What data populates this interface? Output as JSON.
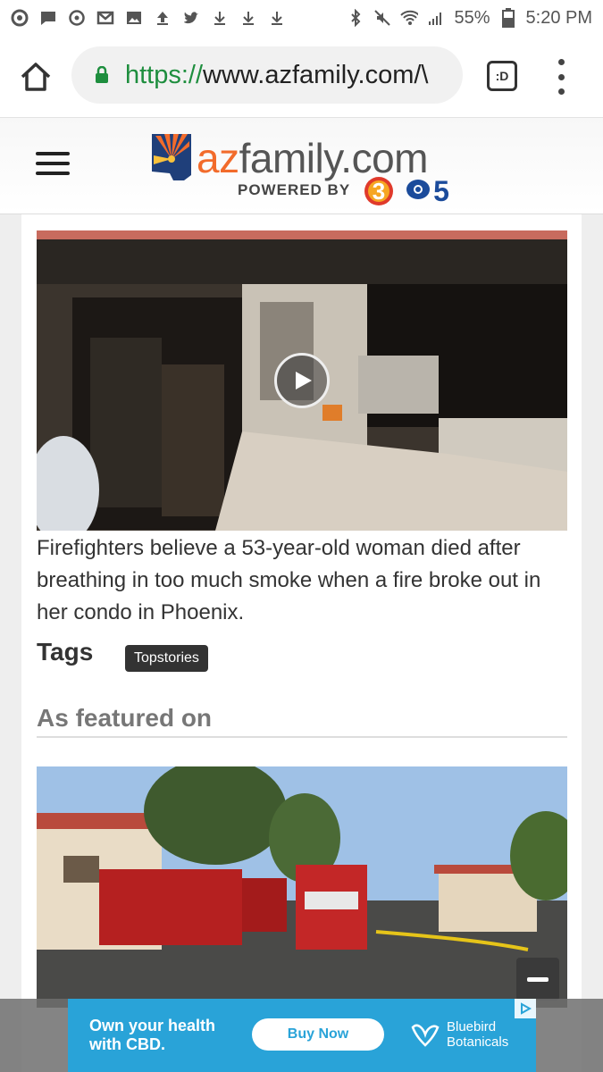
{
  "status_bar": {
    "battery": "55%",
    "time": "5:20 PM",
    "left_icons": [
      "chrome-icon",
      "message-icon",
      "sync-icon",
      "gmail-icon",
      "image-icon",
      "upload-icon",
      "twitter-icon",
      "download-icon",
      "download-icon",
      "download-icon"
    ],
    "right_icons": [
      "bluetooth-icon",
      "mute-icon",
      "wifi-icon",
      "signal-icon",
      "battery-icon"
    ]
  },
  "browser": {
    "url_scheme": "https://",
    "url_host": "www.azfamily.com/\\",
    "tab_label": ":D"
  },
  "site": {
    "logo_az": "az",
    "logo_rest": "family.com",
    "powered_by": "POWERED BY",
    "channel_3": "3",
    "channel_5": "5"
  },
  "article": {
    "caption": "Firefighters believe a 53-year-old woman died after breathing in too much smoke when a fire broke out in her condo in Phoenix.",
    "tags_label": "Tags",
    "tags": [
      "Topstories"
    ],
    "featured_heading": "As featured on"
  },
  "ad": {
    "headline": "Own your health with CBD.",
    "cta": "Buy Now",
    "brand_line1": "Bluebird",
    "brand_line2": "Botanicals",
    "background": "#29a3d8"
  },
  "colors": {
    "brand_orange": "#f26b2b",
    "url_green": "#1e8e3e",
    "tag_chip": "#333333"
  }
}
